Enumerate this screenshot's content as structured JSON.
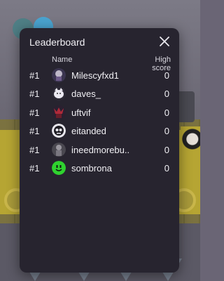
{
  "modal": {
    "title": "Leaderboard",
    "columns": {
      "name": "Name",
      "score": "High score"
    },
    "rows": [
      {
        "rank": "#1",
        "name": "Milescyfxd1",
        "score": "0",
        "avatar_icon": "avatar-dark-character"
      },
      {
        "rank": "#1",
        "name": "daves_",
        "score": "0",
        "avatar_icon": "avatar-white-cat"
      },
      {
        "rank": "#1",
        "name": "uftvif",
        "score": "0",
        "avatar_icon": "avatar-red-character"
      },
      {
        "rank": "#1",
        "name": "eitanded",
        "score": "0",
        "avatar_icon": "avatar-skull-face"
      },
      {
        "rank": "#1",
        "name": "ineedmorebu..",
        "score": "0",
        "avatar_icon": "avatar-grey-figure"
      },
      {
        "rank": "#1",
        "name": "sombrona",
        "score": "0",
        "avatar_icon": "avatar-green-smiley"
      }
    ],
    "close_icon": "close-icon"
  }
}
